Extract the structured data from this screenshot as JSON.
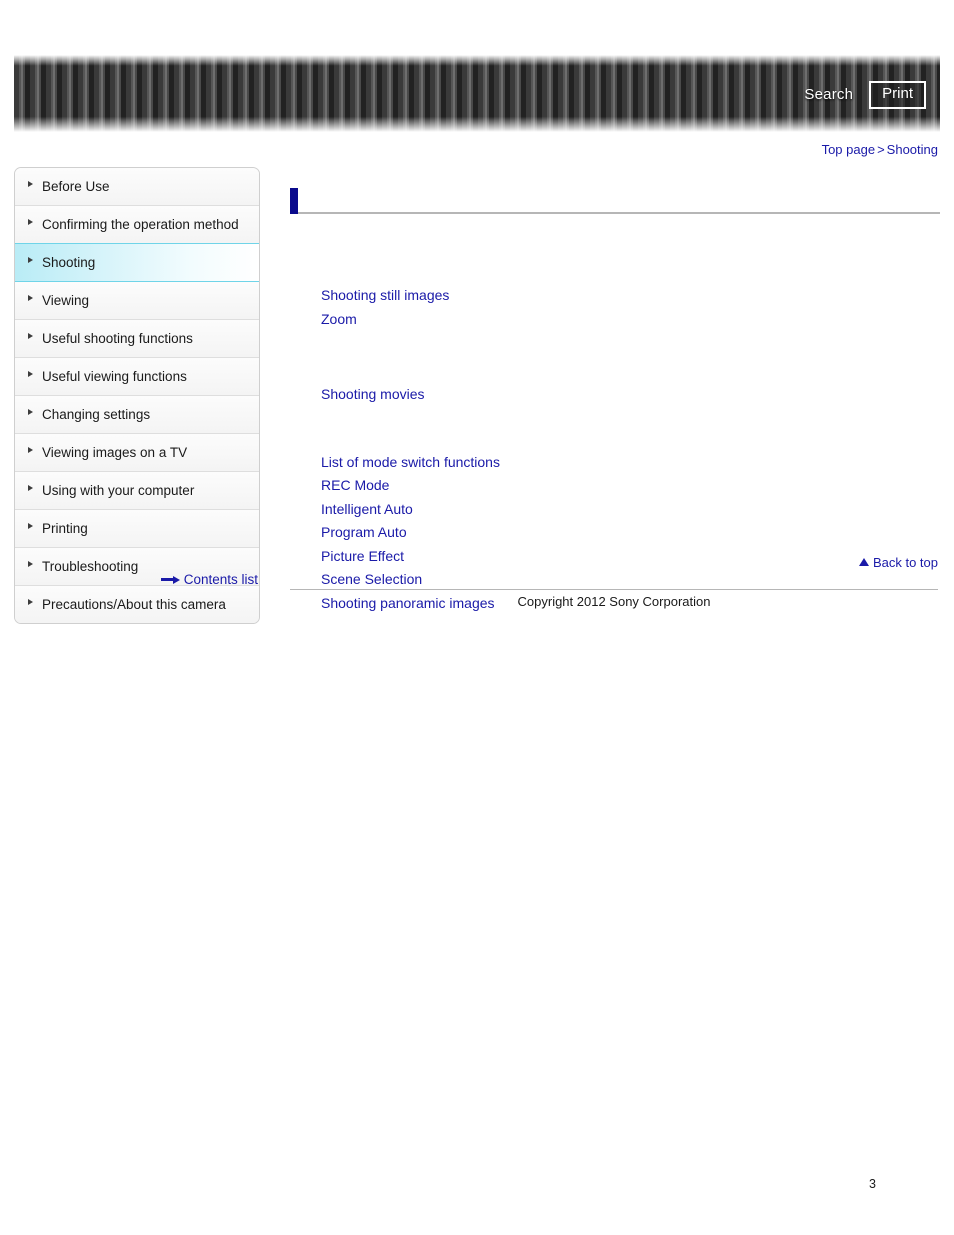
{
  "header": {
    "search_label": "Search",
    "print_label": "Print"
  },
  "breadcrumb": {
    "top_page": "Top page",
    "separator": ">",
    "current": "Shooting"
  },
  "sidebar": {
    "items": [
      {
        "label": "Before Use",
        "active": false
      },
      {
        "label": "Confirming the operation method",
        "active": false
      },
      {
        "label": "Shooting",
        "active": true
      },
      {
        "label": "Viewing",
        "active": false
      },
      {
        "label": "Useful shooting functions",
        "active": false
      },
      {
        "label": "Useful viewing functions",
        "active": false
      },
      {
        "label": "Changing settings",
        "active": false
      },
      {
        "label": "Viewing images on a TV",
        "active": false
      },
      {
        "label": "Using with your computer",
        "active": false
      },
      {
        "label": "Printing",
        "active": false
      },
      {
        "label": "Troubleshooting",
        "active": false
      },
      {
        "label": "Precautions/About this camera",
        "active": false
      }
    ],
    "contents_list_label": "Contents list"
  },
  "main": {
    "page_title": "",
    "groups": [
      {
        "heading": "",
        "links": [
          "Shooting still images",
          "Zoom"
        ]
      },
      {
        "heading": "",
        "links": [
          "Shooting movies"
        ]
      },
      {
        "heading": "",
        "links": [
          "List of mode switch functions",
          "REC Mode",
          "Intelligent Auto",
          "Program Auto",
          "Picture Effect",
          "Scene Selection",
          "Shooting panoramic images"
        ]
      }
    ]
  },
  "footer": {
    "back_to_top_label": "Back to top",
    "copyright": "Copyright 2012 Sony Corporation",
    "page_number": "3"
  },
  "colors": {
    "link": "#1a1aa8",
    "title_marker": "#0a0a8c",
    "active_nav": "#b9ecf6",
    "rule": "#b6b6b6"
  }
}
